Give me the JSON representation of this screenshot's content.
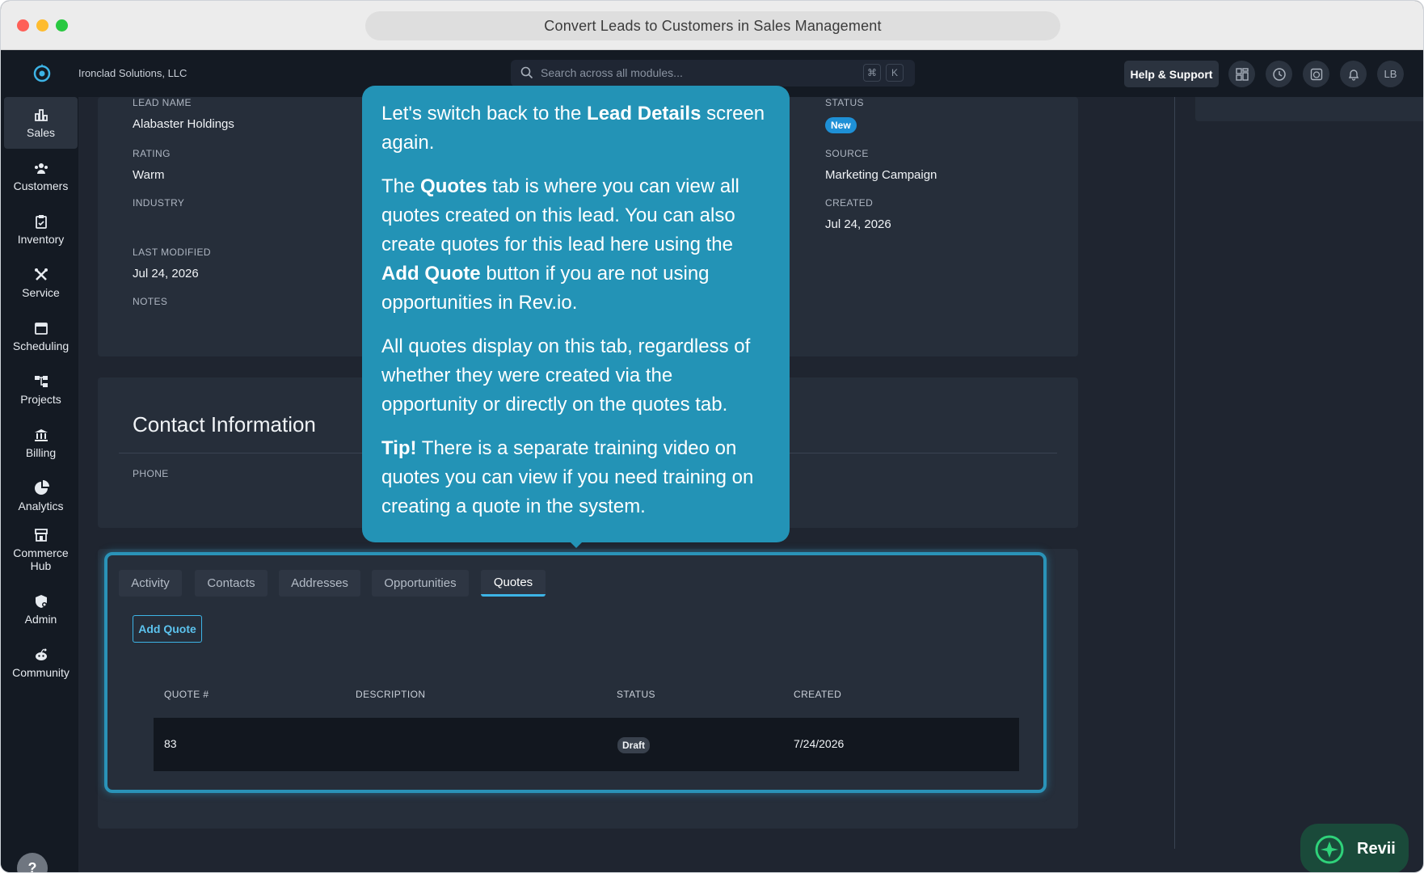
{
  "window": {
    "url_title": "Convert Leads to Customers in Sales Management"
  },
  "topnav": {
    "company": "Ironclad Solutions, LLC",
    "search_placeholder": "Search across all modules...",
    "kbd_cmd": "⌘",
    "kbd_k": "K",
    "help_label": "Help & Support",
    "avatar_initials": "LB"
  },
  "sidebar": {
    "items": [
      {
        "label": "Sales",
        "icon": "bar-chart-icon"
      },
      {
        "label": "Customers",
        "icon": "users-icon"
      },
      {
        "label": "Inventory",
        "icon": "clipboard-icon"
      },
      {
        "label": "Service",
        "icon": "tools-icon"
      },
      {
        "label": "Scheduling",
        "icon": "calendar-icon"
      },
      {
        "label": "Projects",
        "icon": "hierarchy-icon"
      },
      {
        "label": "Billing",
        "icon": "bank-icon"
      },
      {
        "label": "Analytics",
        "icon": "pie-chart-icon"
      },
      {
        "label": "Commerce Hub",
        "icon": "store-icon"
      },
      {
        "label": "Admin",
        "icon": "shield-gear-icon"
      },
      {
        "label": "Community",
        "icon": "community-icon"
      }
    ],
    "help": "?"
  },
  "lead": {
    "lead_name_label": "LEAD NAME",
    "lead_name": "Alabaster Holdings",
    "rating_label": "RATING",
    "rating": "Warm",
    "industry_label": "INDUSTRY",
    "last_modified_label": "LAST MODIFIED",
    "last_modified": "Jul 24, 2026",
    "notes_label": "NOTES",
    "status_label": "STATUS",
    "status": "New",
    "source_label": "SOURCE",
    "source": "Marketing Campaign",
    "created_label": "CREATED",
    "created": "Jul 24, 2026"
  },
  "contact": {
    "title": "Contact Information",
    "phone_label": "PHONE"
  },
  "tabs": [
    "Activity",
    "Contacts",
    "Addresses",
    "Opportunities",
    "Quotes"
  ],
  "quotes": {
    "add_button": "Add Quote",
    "columns": [
      "QUOTE #",
      "DESCRIPTION",
      "STATUS",
      "CREATED"
    ],
    "rows": [
      {
        "quote_no": "83",
        "description": "",
        "status": "Draft",
        "created": "7/24/2026"
      }
    ]
  },
  "tooltip": {
    "p1_a": "Let's switch back to the ",
    "p1_b": "Lead Details",
    "p1_c": " screen again.",
    "p2_a": "The ",
    "p2_b": "Quotes",
    "p2_c": " tab is where you can view all quotes created on this lead. You can also create quotes for this lead here using the ",
    "p2_d": "Add Quote",
    "p2_e": " button if you are not using opportunities in Rev.io.",
    "p3": "All quotes display on this tab, regardless of whether they were created via the opportunity or directly on the quotes tab.",
    "p4_a": "Tip!",
    "p4_b": " There is a separate training video on quotes you can view if you need training on creating a quote in the system."
  },
  "assistant": {
    "label": "Revii"
  },
  "colors": {
    "accent": "#2393b6",
    "highlight": "#2a93b8",
    "status_new": "#1e90d6",
    "revii_bg": "#1a4a3a"
  }
}
